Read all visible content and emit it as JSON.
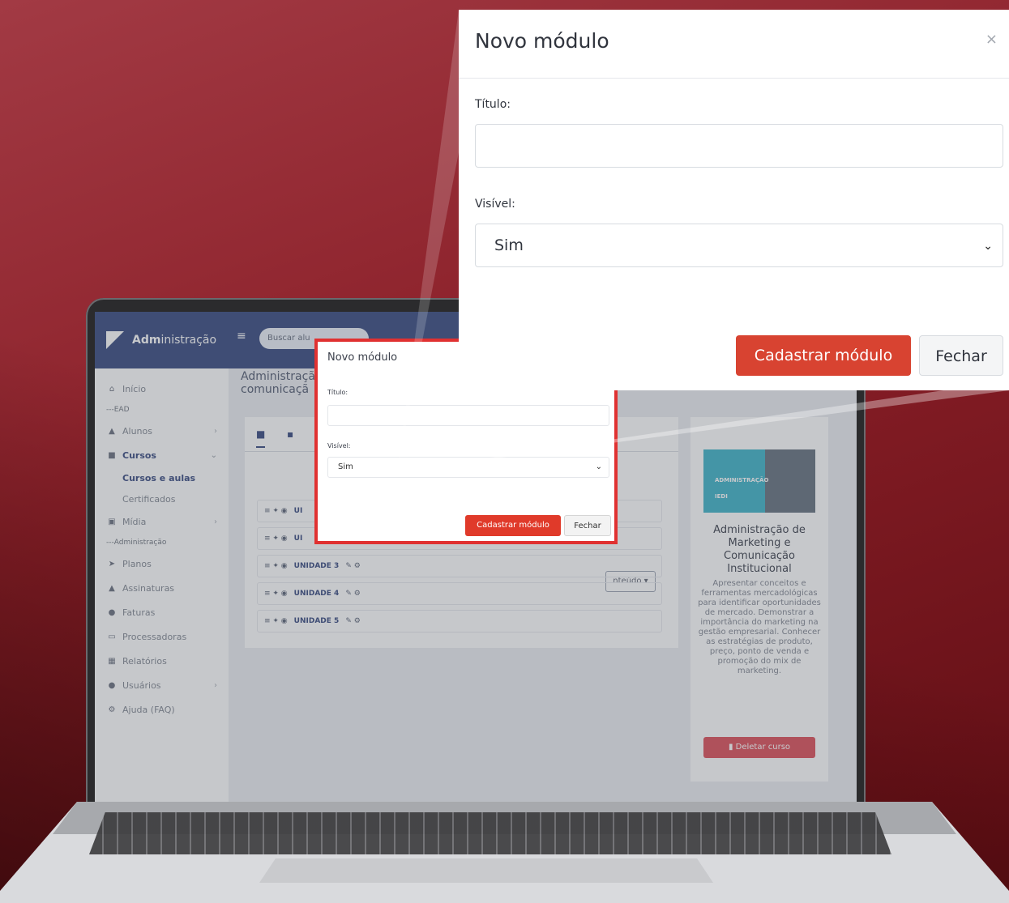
{
  "colors": {
    "accent": "#d84331",
    "navy": "#172c6b",
    "highlight": "#e03131",
    "danger": "#d8333e"
  },
  "app": {
    "brand_bold": "Adm",
    "brand_rest": "inistração",
    "search_placeholder": "Buscar alu",
    "breadcrumb_line1": "Administraçã",
    "breadcrumb_line2": "comunicaçã"
  },
  "sidebar": {
    "items": [
      {
        "label": "Início",
        "icon": "home-icon"
      },
      {
        "label": "EAD",
        "section": true
      },
      {
        "label": "Alunos",
        "icon": "graduation-cap-icon",
        "chevron": ">"
      },
      {
        "label": "Cursos",
        "icon": "book-icon",
        "chevron": "v",
        "active": true
      },
      {
        "label": "Cursos e aulas",
        "sub": true,
        "on": true
      },
      {
        "label": "Certificados",
        "sub": true
      },
      {
        "label": "Mídia",
        "icon": "media-icon",
        "chevron": ">"
      },
      {
        "label": "Administração",
        "section": true
      },
      {
        "label": "Planos",
        "icon": "paper-plane-icon"
      },
      {
        "label": "Assinaturas",
        "icon": "lock-icon"
      },
      {
        "label": "Faturas",
        "icon": "invoice-icon"
      },
      {
        "label": "Processadoras",
        "icon": "credit-card-icon"
      },
      {
        "label": "Relatórios",
        "icon": "chart-icon"
      },
      {
        "label": "Usuários",
        "icon": "users-icon",
        "chevron": ">"
      },
      {
        "label": "Ajuda (FAQ)",
        "icon": "help-icon"
      }
    ]
  },
  "course": {
    "content_button": "nteúdo ▾",
    "units": [
      "UNIDADE 3",
      "UNIDADE 4",
      "UNIDADE 5"
    ],
    "unit_prefix_partial": [
      "UI",
      "UI"
    ],
    "thumbnail_text": "ADMINISTRAÇÃO",
    "thumbnail_brand": "IEDI",
    "title": "Administração de Marketing e Comunicação Institucional",
    "description": "Apresentar conceitos e ferramentas mercadológicas para identificar oportunidades de mercado. Demonstrar a importância do marketing na gestão empresarial. Conhecer as estratégias de produto, preço, ponto de venda e promoção do mix de marketing.",
    "delete_button": "Deletar curso"
  },
  "modal": {
    "title": "Novo módulo",
    "title_label": "Título:",
    "title_value": "",
    "visible_label": "Visível:",
    "visible_value": "Sim",
    "submit_label": "Cadastrar módulo",
    "close_label": "Fechar",
    "close_icon": "×"
  }
}
